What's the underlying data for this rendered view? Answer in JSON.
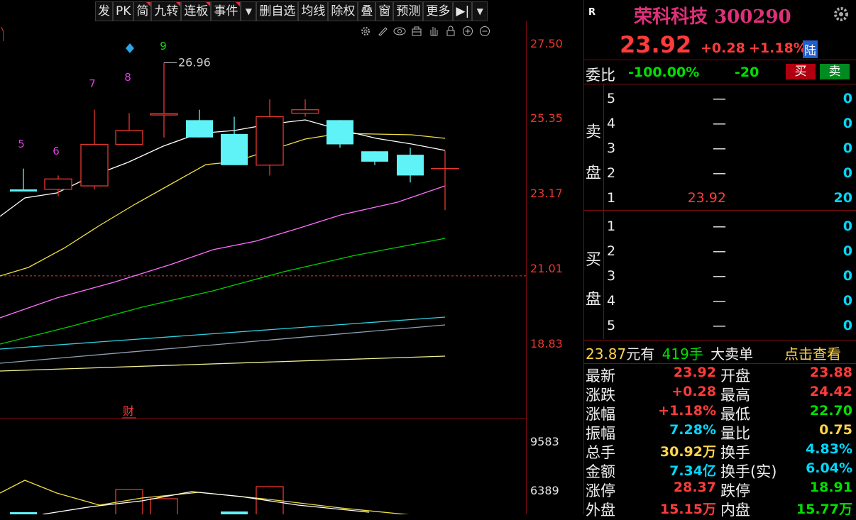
{
  "toolbar": {
    "buttons": [
      "发",
      "PK",
      "简",
      "九转",
      "连板",
      "事件",
      "▼",
      "删自选",
      "均线",
      "除权",
      "叠",
      "窗",
      "预测",
      "更多",
      "▶|",
      "▼"
    ]
  },
  "chart_icons": [
    "gear-icon",
    "pen-icon",
    "eye-icon",
    "toolbox-icon",
    "hand-icon",
    "lock-icon",
    "zoom-in-icon",
    "zoom-out-icon"
  ],
  "chart_data": {
    "type": "candlestick",
    "price_axis": [
      "27.50",
      "25.35",
      "23.17",
      "21.01",
      "18.83"
    ],
    "volume_axis": [
      "9583",
      "6389"
    ],
    "ylim": [
      17.6,
      28.1
    ],
    "peak_label": "26.96",
    "td_counts": [
      "5",
      "6",
      "7",
      "8",
      "9"
    ],
    "finance_marker": "财",
    "candles": [
      {
        "o": 23.3,
        "c": 23.3,
        "h": 23.9,
        "l": 23.3,
        "up": false
      },
      {
        "o": 23.3,
        "c": 23.6,
        "h": 23.7,
        "l": 23.1,
        "up": true
      },
      {
        "o": 23.4,
        "c": 24.6,
        "h": 25.6,
        "l": 23.3,
        "up": true
      },
      {
        "o": 24.6,
        "c": 25.0,
        "h": 25.5,
        "l": 24.6,
        "up": true
      },
      {
        "o": 25.49,
        "c": 25.45,
        "h": 26.96,
        "l": 24.8,
        "up": true
      },
      {
        "o": 25.3,
        "c": 24.8,
        "h": 25.6,
        "l": 24.8,
        "up": false
      },
      {
        "o": 24.9,
        "c": 24.0,
        "h": 25.4,
        "l": 24.0,
        "up": false
      },
      {
        "o": 24.0,
        "c": 25.4,
        "h": 25.9,
        "l": 23.7,
        "up": true
      },
      {
        "o": 25.5,
        "c": 25.6,
        "h": 25.9,
        "l": 25.4,
        "up": true
      },
      {
        "o": 25.3,
        "c": 24.6,
        "h": 25.3,
        "l": 24.5,
        "up": false
      },
      {
        "o": 24.4,
        "c": 24.1,
        "h": 24.4,
        "l": 24.0,
        "up": false
      },
      {
        "o": 24.3,
        "c": 23.7,
        "h": 24.5,
        "l": 23.5,
        "up": false
      },
      {
        "o": 23.88,
        "c": 23.92,
        "h": 24.42,
        "l": 22.7,
        "up": true
      }
    ],
    "dashed_level": 20.8,
    "colors": {
      "up": "#e8382f",
      "down": "#5ff3f7",
      "ma5": "#ffffff",
      "ma10": "#f0e040",
      "ma20": "#ff70ff",
      "ma30": "#00d000",
      "ma60": "#2fd0e0",
      "ma120": "#8fa0b0",
      "ma250": "#f0f090"
    }
  },
  "stock": {
    "badge": "R",
    "name": "荣科科技",
    "code": "300290",
    "price": "23.92",
    "change": "+0.28",
    "change_pct": "+1.18%",
    "tag": "陆"
  },
  "weibi": {
    "label": "委比",
    "pct": "-100.00%",
    "diff": "-20",
    "buy": "买",
    "sell": "卖"
  },
  "sell_side": {
    "label1": "卖",
    "label2": "盘",
    "rows": [
      {
        "lvl": "5",
        "price": "—",
        "vol": "0"
      },
      {
        "lvl": "4",
        "price": "—",
        "vol": "0"
      },
      {
        "lvl": "3",
        "price": "—",
        "vol": "0"
      },
      {
        "lvl": "2",
        "price": "—",
        "vol": "0"
      },
      {
        "lvl": "1",
        "price": "23.92",
        "vol": "20"
      }
    ]
  },
  "buy_side": {
    "label1": "买",
    "label2": "盘",
    "rows": [
      {
        "lvl": "1",
        "price": "—",
        "vol": "0"
      },
      {
        "lvl": "2",
        "price": "—",
        "vol": "0"
      },
      {
        "lvl": "3",
        "price": "—",
        "vol": "0"
      },
      {
        "lvl": "4",
        "price": "—",
        "vol": "0"
      },
      {
        "lvl": "5",
        "price": "—",
        "vol": "0"
      }
    ]
  },
  "big_order": {
    "price": "23.87",
    "unit": "元有",
    "lots": "419手",
    "text": "大卖单",
    "link": "点击查看"
  },
  "stats": [
    {
      "l1": "最新",
      "v1": "23.92",
      "c1": "red",
      "l2": "开盘",
      "v2": "23.88",
      "c2": "red"
    },
    {
      "l1": "涨跌",
      "v1": "+0.28",
      "c1": "red",
      "l2": "最高",
      "v2": "24.42",
      "c2": "red"
    },
    {
      "l1": "涨幅",
      "v1": "+1.18%",
      "c1": "red",
      "l2": "最低",
      "v2": "22.70",
      "c2": "green"
    },
    {
      "l1": "振幅",
      "v1": "7.28%",
      "c1": "cyan",
      "l2": "量比",
      "v2": "0.75",
      "c2": "yellow"
    },
    {
      "l1": "总手",
      "v1": "30.92万",
      "c1": "yellow",
      "l2": "换手",
      "v2": "4.83%",
      "c2": "cyan"
    },
    {
      "l1": "金额",
      "v1": "7.34亿",
      "c1": "cyan",
      "l2": "换手(实)",
      "v2": "6.04%",
      "c2": "cyan"
    },
    {
      "l1": "涨停",
      "v1": "28.37",
      "c1": "red",
      "l2": "跌停",
      "v2": "18.91",
      "c2": "green"
    },
    {
      "l1": "外盘",
      "v1": "15.15万",
      "c1": "red",
      "l2": "内盘",
      "v2": "15.77万",
      "c2": "green"
    }
  ]
}
